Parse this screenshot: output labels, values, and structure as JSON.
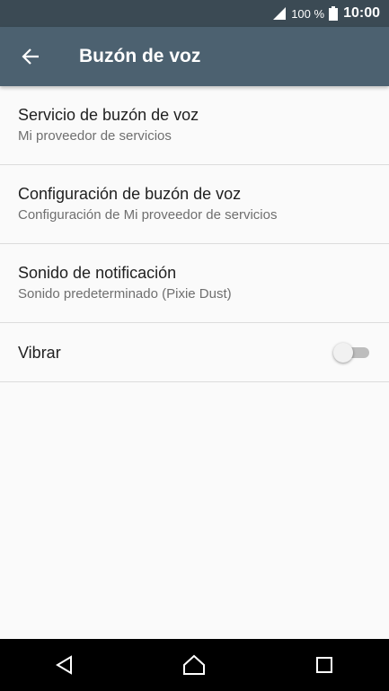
{
  "status_bar": {
    "battery_percent": "100 %",
    "time": "10:00"
  },
  "app_bar": {
    "title": "Buzón de voz"
  },
  "settings": [
    {
      "title": "Servicio de buzón de voz",
      "subtitle": "Mi proveedor de servicios"
    },
    {
      "title": "Configuración de buzón de voz",
      "subtitle": "Configuración de Mi proveedor de servicios"
    },
    {
      "title": "Sonido de notificación",
      "subtitle": "Sonido predeterminado (Pixie Dust)"
    }
  ],
  "vibrate": {
    "label": "Vibrar",
    "enabled": false
  },
  "colors": {
    "status_bar": "#3b4a54",
    "app_bar": "#4c6170",
    "background": "#fafafa",
    "nav_bar": "#000000"
  },
  "icons": {
    "back": "arrow-left-icon",
    "signal": "signal-icon",
    "battery": "battery-icon",
    "nav_back": "triangle-back-icon",
    "nav_home": "circle-home-icon",
    "nav_recents": "square-recents-icon"
  }
}
